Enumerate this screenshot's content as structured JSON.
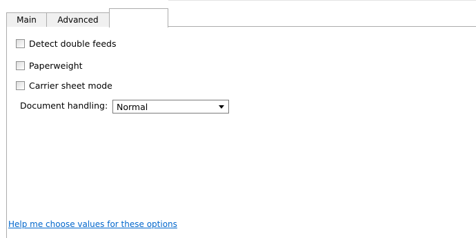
{
  "tabs": [
    {
      "label": "Main"
    },
    {
      "label": "Advanced"
    },
    {
      "label": ""
    }
  ],
  "options": {
    "detect_double_feeds": {
      "label": "Detect double feeds",
      "checked": false
    },
    "paperweight": {
      "label": "Paperweight",
      "checked": false
    },
    "carrier_sheet_mode": {
      "label": "Carrier sheet mode",
      "checked": false
    }
  },
  "document_handling": {
    "label": "Document handling:",
    "value": "Normal"
  },
  "help_link": "Help me choose values for these options"
}
